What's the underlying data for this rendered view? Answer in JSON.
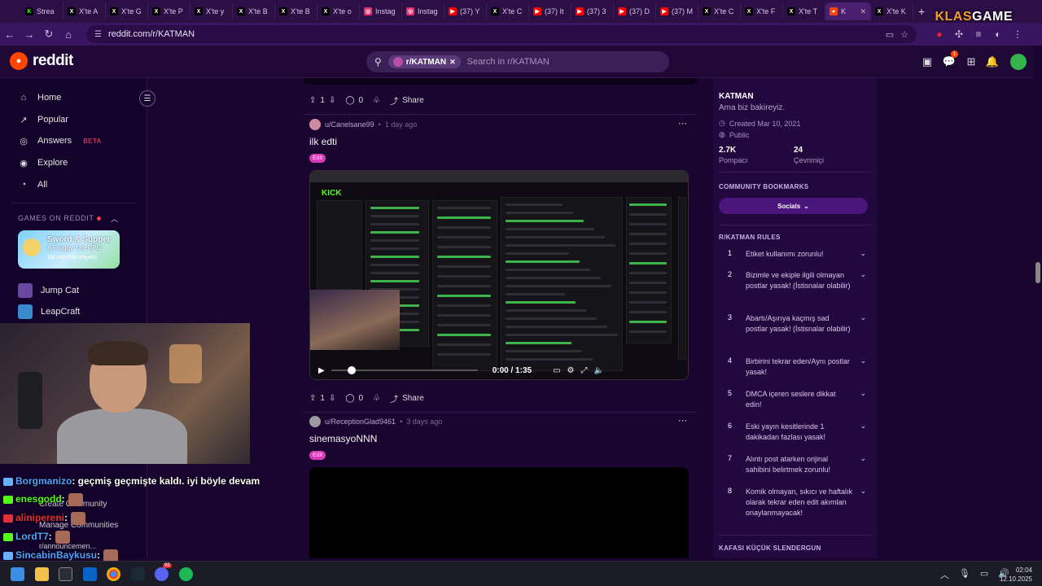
{
  "browser": {
    "tabs": [
      {
        "label": "Strea",
        "favicon": "kick",
        "color": "#53fc18"
      },
      {
        "label": "X'te A",
        "favicon": "x",
        "color": "#ffffff"
      },
      {
        "label": "X'te G",
        "favicon": "x",
        "color": "#ffffff"
      },
      {
        "label": "X'te P",
        "favicon": "x",
        "color": "#ffffff"
      },
      {
        "label": "X'te y",
        "favicon": "x",
        "color": "#ffffff"
      },
      {
        "label": "X'te B",
        "favicon": "x",
        "color": "#ffffff"
      },
      {
        "label": "X'te B",
        "favicon": "x",
        "color": "#ffffff"
      },
      {
        "label": "X'te o",
        "favicon": "x",
        "color": "#ffffff"
      },
      {
        "label": "Instag",
        "favicon": "instagram",
        "color": "#e1306c"
      },
      {
        "label": "Instag",
        "favicon": "instagram",
        "color": "#e1306c"
      },
      {
        "label": "(37) Y",
        "favicon": "youtube",
        "color": "#ff0000"
      },
      {
        "label": "X'te C",
        "favicon": "x",
        "color": "#ffffff"
      },
      {
        "label": "(37) It",
        "favicon": "youtube",
        "color": "#ff0000"
      },
      {
        "label": "(37) 3",
        "favicon": "youtube",
        "color": "#ff0000"
      },
      {
        "label": "(37) D",
        "favicon": "youtube",
        "color": "#ff0000"
      },
      {
        "label": "(37) M",
        "favicon": "youtube",
        "color": "#ff0000"
      },
      {
        "label": "X'te C",
        "favicon": "x",
        "color": "#ffffff"
      },
      {
        "label": "X'te F",
        "favicon": "x",
        "color": "#ffffff"
      },
      {
        "label": "X'te T",
        "favicon": "x",
        "color": "#ffffff"
      },
      {
        "label": "K",
        "favicon": "reddit",
        "color": "#ff4500",
        "active": true
      },
      {
        "label": "X'te K",
        "favicon": "x",
        "color": "#ffffff"
      }
    ],
    "url": "reddit.com/r/KATMAN",
    "watermark_a": "KLAS",
    "watermark_b": "GAME"
  },
  "header": {
    "logo_text": "reddit",
    "search_chip": "r/KATMAN",
    "search_placeholder": "Search in r/KATMAN",
    "notification_count": "1"
  },
  "leftnav": {
    "items": [
      {
        "label": "Home",
        "icon": "home-icon"
      },
      {
        "label": "Popular",
        "icon": "popular-icon"
      },
      {
        "label": "Answers",
        "icon": "answers-icon",
        "badge": "BETA"
      },
      {
        "label": "Explore",
        "icon": "explore-icon"
      },
      {
        "label": "All",
        "icon": "all-icon"
      }
    ],
    "games_title": "GAMES ON REDDIT",
    "game_card": {
      "title": "Sword & Supper",
      "subtitle": "A Froggy Idle RPG",
      "players": "1M monthly players"
    },
    "games": [
      "Jump Cat",
      "LeapCraft"
    ],
    "bottom_items": [
      "Create Community",
      "Manage Communities",
      "r/announcemen..."
    ]
  },
  "feed": {
    "top_actions": {
      "votes": "1",
      "comments": "0",
      "share": "Share"
    },
    "post1": {
      "user": "u/Canelsane99",
      "time": "1 day ago",
      "title": "ilk edti",
      "flair": "Edit",
      "video_time": "0:00 / 1:35",
      "kick_logo": "KICK",
      "votes": "1",
      "comments": "0",
      "share": "Share"
    },
    "post2": {
      "user": "u/ReceptionGlad9461",
      "time": "3 days ago",
      "title": "sinemasyoNNN",
      "flair": "Edit"
    }
  },
  "sidebar": {
    "name": "KATMAN",
    "description": "Ama biz bakireyiz.",
    "created": "Created Mar 10, 2021",
    "visibility": "Public",
    "members": "2.7K",
    "members_label": "Pompacı",
    "online": "24",
    "online_label": "Çevrimiçi",
    "bookmarks_title": "COMMUNITY BOOKMARKS",
    "bookmark_button": "Socials",
    "rules_title": "R/KATMAN RULES",
    "rules": [
      {
        "n": "1",
        "text": "Etiket kullanımı zorunlu!"
      },
      {
        "n": "2",
        "text": "Bizimle ve ekiple ilgili olmayan postlar yasak! (İstisnalar olabilir)"
      },
      {
        "n": "3",
        "text": "Abartı/Aşırıya kaçmış sad postlar yasak! (İstisnalar olabilir)"
      },
      {
        "n": "4",
        "text": "Birbirini tekrar eden/Aynı postlar yasak!"
      },
      {
        "n": "5",
        "text": "DMCA içeren seslere dikkat edin!"
      },
      {
        "n": "6",
        "text": "Eski yayın kesitlerinde 1 dakikadan fazlası yasak!"
      },
      {
        "n": "7",
        "text": "Alıntı post atarken orijinal sahibini belirtmek zorunlu!"
      },
      {
        "n": "8",
        "text": "Komik olmayan, sıkıcı ve haftalık olarak tekrar eden edit akımları onaylanmayacak!"
      }
    ],
    "next_section": "KAFASI KÜÇÜK SLENDERGUN"
  },
  "chat": [
    {
      "user": "Borgmanizo",
      "msg": ": geçmiş geçmişte kaldı. iyi böyle devam",
      "color": "#4fa3ff"
    },
    {
      "user": "enesgodd",
      "msg": ":",
      "color": "#53fc18"
    },
    {
      "user": "alinipereni",
      "msg": ":",
      "color": "#e0303a"
    },
    {
      "user": "LordT7",
      "msg": ":",
      "color": "#4fa3ff"
    },
    {
      "user": "SincabinBaykusu",
      "msg": ":",
      "color": "#4fa3ff"
    }
  ],
  "taskbar": {
    "time": "02:04",
    "date": "12.10.2025",
    "discord_badge": "99"
  }
}
